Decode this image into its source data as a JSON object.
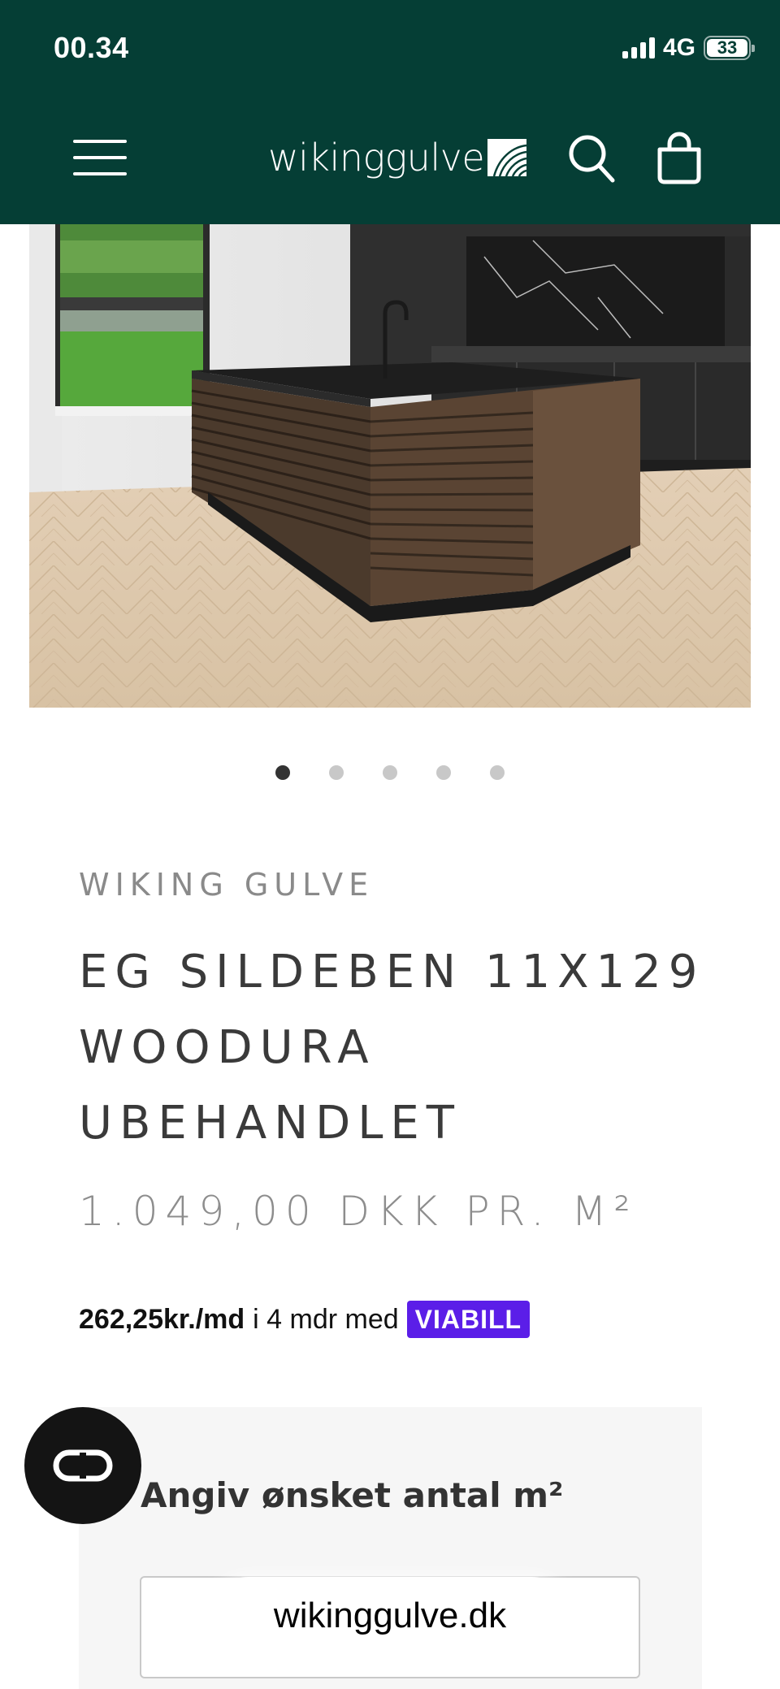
{
  "status_bar": {
    "time": "00.34",
    "network": "4G",
    "battery": "33"
  },
  "header": {
    "brand": "wikinggulve",
    "icons": [
      "menu-icon",
      "search-icon",
      "shopping-bag-icon"
    ],
    "background_color": "#053e35"
  },
  "gallery": {
    "image_count": 5,
    "active_index": 0
  },
  "product": {
    "vendor": "WIKING GULVE",
    "title_lines": [
      "EG SILDEBEN 11X129",
      "WOODURA",
      "UBEHANDLET"
    ],
    "price": "1.049,00 DKK PR. M²"
  },
  "financing": {
    "amount": "262,25kr./md",
    "text": "i 4 mdr med",
    "badge": "VIABILL",
    "badge_color": "#5b1ee8"
  },
  "quantity": {
    "label": "Angiv ønsket antal m²"
  },
  "chat": {
    "icon": "chat-loop-icon"
  },
  "browser": {
    "url": "wikinggulve.dk"
  }
}
